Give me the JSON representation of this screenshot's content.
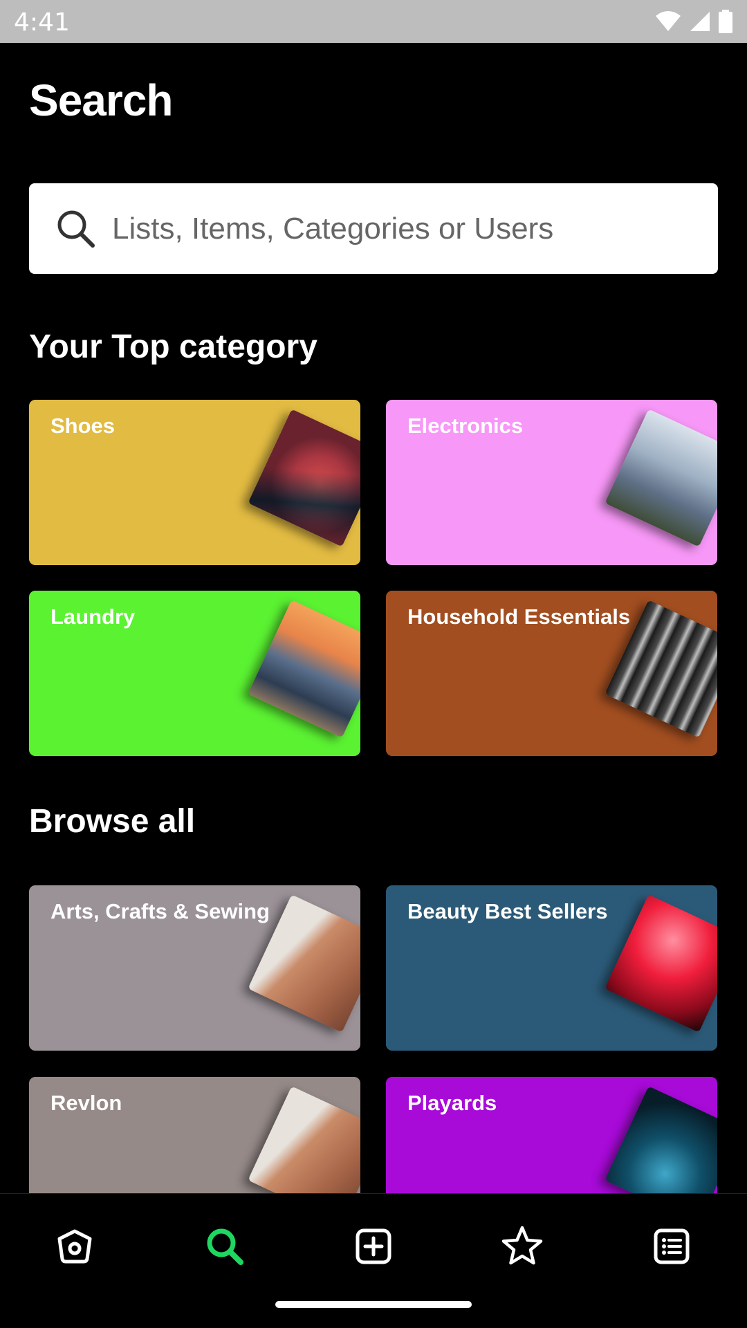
{
  "status_bar": {
    "time": "4:41"
  },
  "page": {
    "title": "Search"
  },
  "search": {
    "placeholder": "Lists, Items, Categories or Users"
  },
  "top_category": {
    "title": "Your Top category",
    "cards": [
      {
        "label": "Shoes",
        "color": "#e2bb42"
      },
      {
        "label": "Electronics",
        "color": "#f797f7"
      },
      {
        "label": "Laundry",
        "color": "#5bf232"
      },
      {
        "label": "Household Essentials",
        "color": "#a24e20"
      }
    ]
  },
  "browse_all": {
    "title": "Browse all",
    "cards": [
      {
        "label": "Arts, Crafts & Sewing",
        "color": "#9b9298"
      },
      {
        "label": "Beauty Best Sellers",
        "color": "#2b5a78"
      },
      {
        "label": "Revlon",
        "color": "#958a88"
      },
      {
        "label": "Playards",
        "color": "#a80ad8"
      }
    ]
  },
  "bottom_nav": {
    "items": [
      {
        "icon": "home-icon",
        "active": false
      },
      {
        "icon": "search-icon",
        "active": true
      },
      {
        "icon": "add-icon",
        "active": false
      },
      {
        "icon": "star-icon",
        "active": false
      },
      {
        "icon": "list-icon",
        "active": false
      }
    ],
    "active_color": "#1ed760",
    "inactive_color": "#ffffff"
  }
}
